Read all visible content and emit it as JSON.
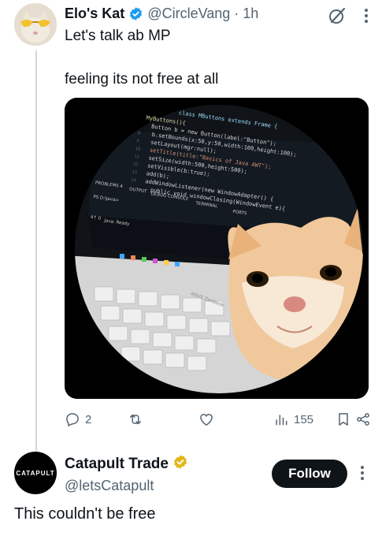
{
  "tweet": {
    "display_name": "Elo's Kat",
    "handle": "@CircleVang",
    "separator": "·",
    "time": "1h",
    "text_line1": "Let's talk ab MP",
    "text_line2": "feeling its not free at all",
    "image": {
      "code_lines": [
        "class MButtons extends Frame {",
        "MyButtons(){",
        "Button b = new Button(label:\"Button\");",
        "b.setBounds(x:50,y:50,width:100,height:100);",
        "setLayout(mgr:null);",
        "setTitle(title:\"Basics of Java AWT\");",
        "setSize(width:500,height:500);",
        "setVisible(b:true);",
        "add(b);",
        "addWindowListener(new WindowAdapter() {",
        "public void windowClosing(WindowEvent e){"
      ],
      "line_numbers": [
        "8",
        "9",
        "10",
        "11",
        "12",
        "13",
        "14"
      ],
      "panel_tabs": [
        "PROBLEMS 4",
        "OUTPUT",
        "DEBUG CONSOLE",
        "TERMINAL",
        "PORTS"
      ],
      "terminal_lines": [
        "PS D:\\Java>"
      ],
      "status_text": "Java: Ready",
      "status_prefix": "4↑ 0",
      "laptop_brand": "ASUS Zenbook"
    },
    "stats": {
      "replies": "2",
      "retweets": "",
      "likes": "",
      "views": "155"
    }
  },
  "reply": {
    "display_name": "Catapult Trade",
    "handle": "@letsCatapult",
    "avatar_text": "CATAPULT",
    "follow_label": "Follow",
    "text": "This couldn't be free"
  },
  "colors": {
    "verified_blue": "#1d9bf0",
    "verified_gold": "#e2b719",
    "muted_text": "#536471",
    "thread_line": "#cfd9de"
  }
}
